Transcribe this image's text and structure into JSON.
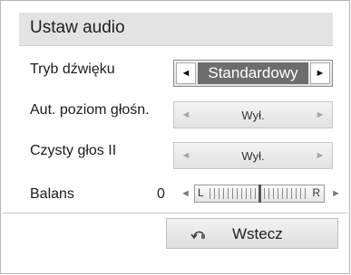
{
  "window": {
    "title": "Ustaw audio"
  },
  "settings": [
    {
      "label": "Tryb dźwięku",
      "value": "Standardowy"
    },
    {
      "label": "Aut. poziom głośn.",
      "value": "Wył."
    },
    {
      "label": "Czysty głos II",
      "value": "Wył."
    }
  ],
  "balance": {
    "label": "Balans",
    "value": "0",
    "left_label": "L",
    "right_label": "R",
    "position": 0.5
  },
  "arrows": {
    "left": "◄",
    "right": "►"
  },
  "back_button": {
    "label": "Wstecz",
    "icon": "back-remote-icon"
  }
}
